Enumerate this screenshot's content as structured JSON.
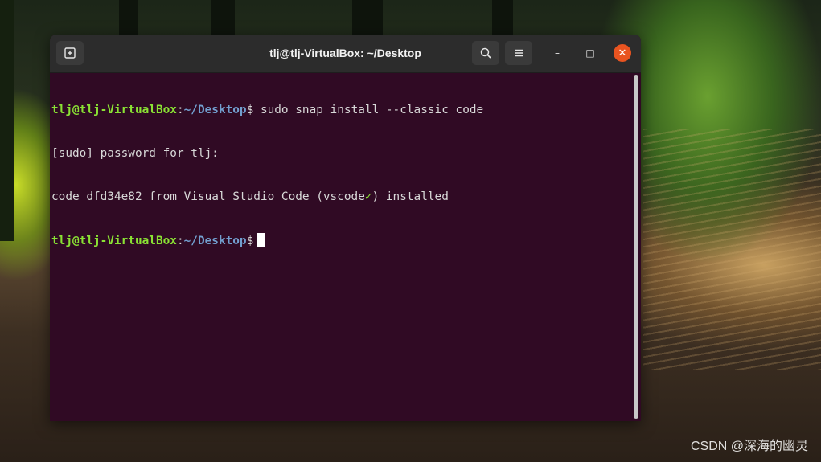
{
  "window": {
    "title": "tlj@tlj-VirtualBox: ~/Desktop",
    "buttons": {
      "new_tab_icon": "new-tab-icon",
      "search_icon": "search-icon",
      "menu_icon": "hamburger-menu-icon",
      "minimize": "–",
      "maximize": "□",
      "close": "✕"
    }
  },
  "terminal": {
    "line1": {
      "user_host": "tlj@tlj-VirtualBox",
      "colon": ":",
      "path": "~/Desktop",
      "dollar": "$",
      "command": " sudo snap install --classic code"
    },
    "line2": {
      "text": "[sudo] password for tlj:"
    },
    "line3": {
      "before": "code dfd34e82 from Visual Studio Code (vscode",
      "check": "✓",
      "after": ") installed"
    },
    "line4": {
      "user_host": "tlj@tlj-VirtualBox",
      "colon": ":",
      "path": "~/Desktop",
      "dollar": "$"
    }
  },
  "colors": {
    "terminal_bg": "#300a24",
    "prompt_user": "#8ae234",
    "prompt_path": "#729fcf",
    "close_button": "#e95420"
  },
  "watermark": "CSDN @深海的幽灵"
}
